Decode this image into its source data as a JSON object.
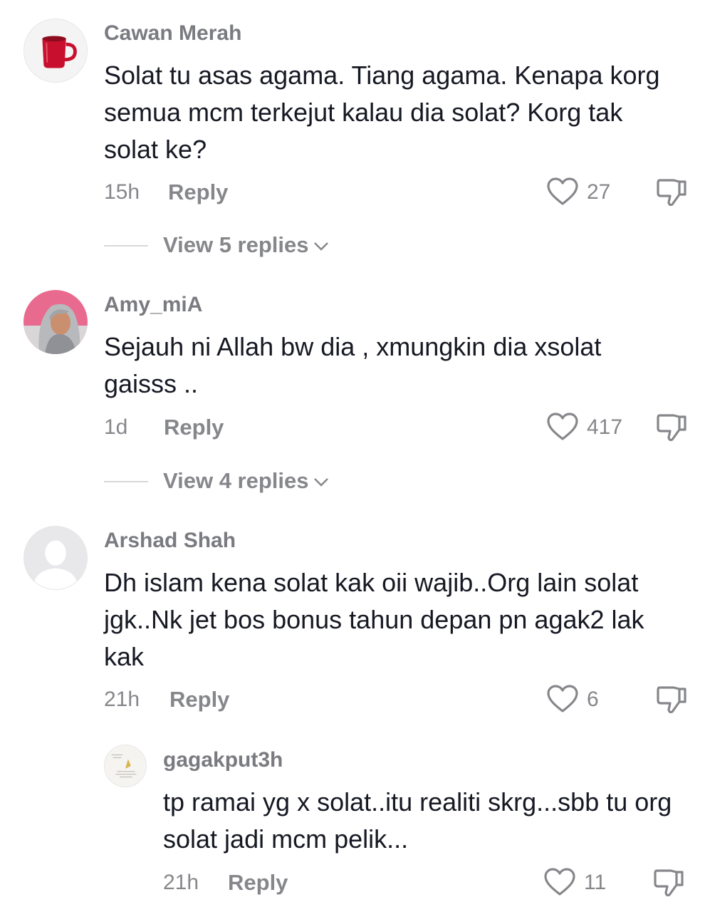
{
  "comments": [
    {
      "username": "Cawan Merah",
      "text": "Solat tu asas agama. Tiang agama. Kenapa korg semua mcm terkejut kalau dia solat? Korg tak solat ke?",
      "time": "15h",
      "reply_label": "Reply",
      "likes": "27",
      "view_replies": "View 5 replies",
      "avatar": "red-mug-avatar"
    },
    {
      "username": "Amy_miA",
      "text": "Sejauh ni Allah bw dia , xmungkin dia xsolat gaisss ..",
      "time": "1d",
      "reply_label": "Reply",
      "likes": "417",
      "view_replies": "View 4 replies",
      "avatar": "hijab-woman-avatar"
    },
    {
      "username": "Arshad Shah",
      "text": "Dh islam kena solat kak oii wajib..Org lain solat jgk..Nk jet bos bonus tahun depan pn agak2 lak kak",
      "time": "21h",
      "reply_label": "Reply",
      "likes": "6",
      "avatar": "default-user-avatar"
    }
  ],
  "reply": {
    "username": "gagakput3h",
    "text": "tp ramai yg x solat..itu realiti skrg...sbb tu org solat jadi mcm pelik...",
    "time": "21h",
    "reply_label": "Reply",
    "likes": "11",
    "avatar": "note-card-avatar"
  },
  "colors": {
    "username": "#7a7b80",
    "meta": "#86878b",
    "text": "#161823"
  }
}
